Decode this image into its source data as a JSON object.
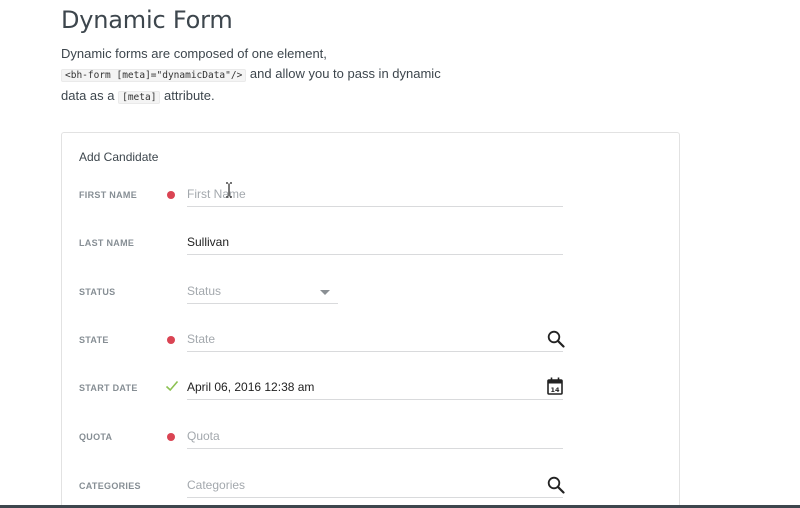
{
  "page": {
    "title": "Dynamic Form",
    "intro": {
      "text1": "Dynamic forms are composed of one element, ",
      "code1": "<bh-form [meta]=\"dynamicData\"/>",
      "text2": " and allow you to pass in dynamic data as a ",
      "code2": "[meta]",
      "text3": " attribute."
    }
  },
  "form": {
    "title": "Add Candidate",
    "fields": {
      "first_name": {
        "label": "FIRST NAME",
        "placeholder": "First Name",
        "value": "",
        "required": true
      },
      "last_name": {
        "label": "LAST NAME",
        "value": "Sullivan"
      },
      "status": {
        "label": "STATUS",
        "placeholder": "Status",
        "icon": "chevron-down-icon"
      },
      "state": {
        "label": "STATE",
        "placeholder": "State",
        "required": true,
        "icon": "search-icon"
      },
      "start_date": {
        "label": "START DATE",
        "value": "April 06, 2016 12:38 am",
        "valid": true,
        "icon": "calendar-icon"
      },
      "quota": {
        "label": "QUOTA",
        "placeholder": "Quota",
        "required": true
      },
      "categories": {
        "label": "CATEGORIES",
        "placeholder": "Categories",
        "icon": "search-icon"
      }
    }
  },
  "colors": {
    "required_indicator": "#da4453",
    "valid_check": "#8cc152",
    "label": "#868e94",
    "text": "#3d464d"
  }
}
